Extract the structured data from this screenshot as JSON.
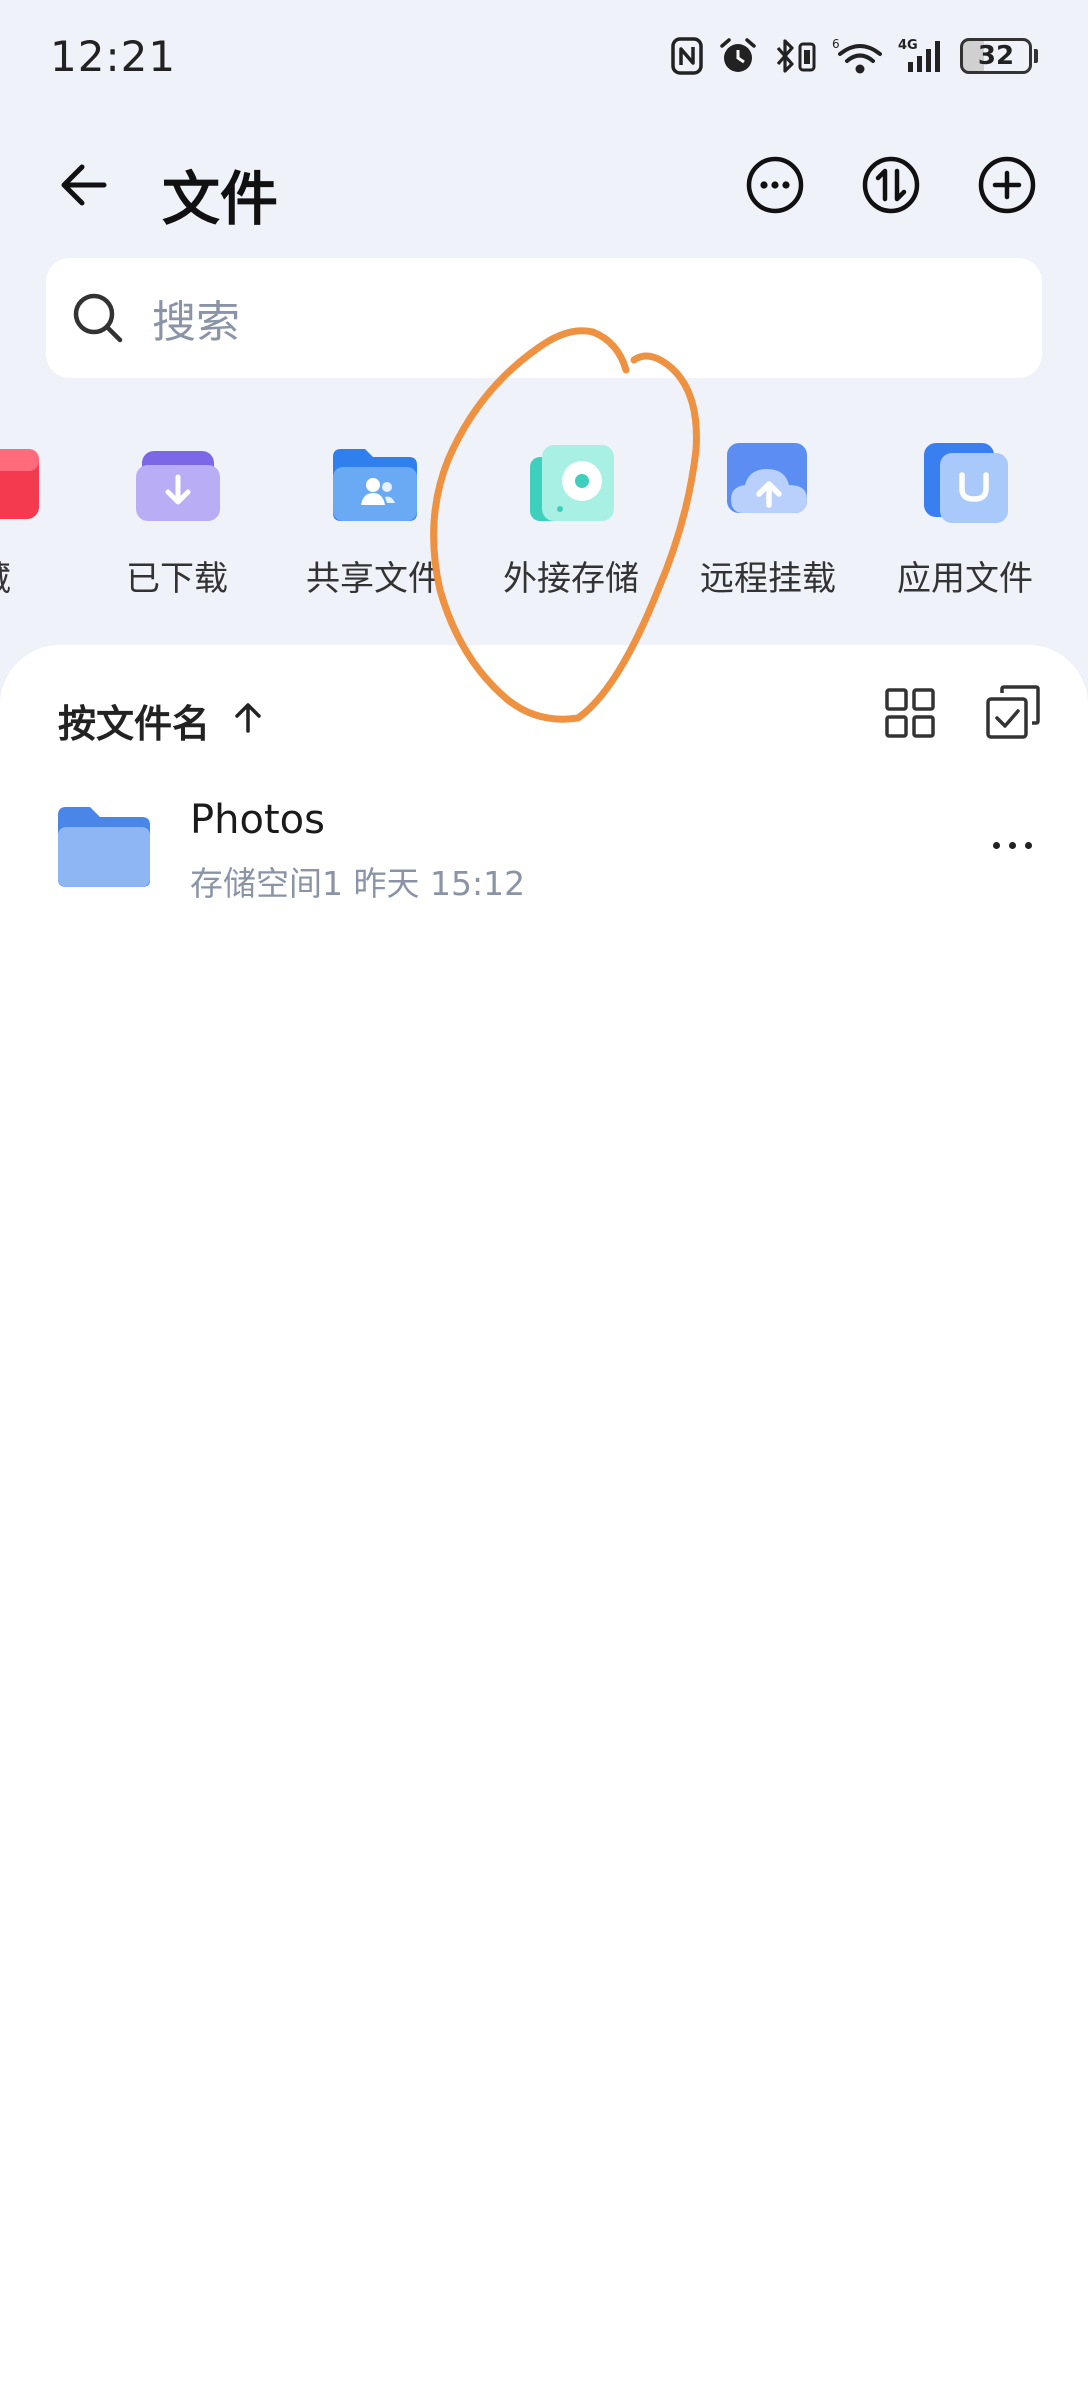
{
  "status_bar": {
    "time": "12:21",
    "network": "4G",
    "battery": "32"
  },
  "header": {
    "title": "文件",
    "back_icon": "arrow-left-icon",
    "actions": [
      "more-circle-icon",
      "transfer-icon",
      "add-circle-icon"
    ]
  },
  "search": {
    "placeholder": "搜索"
  },
  "categories": [
    {
      "label": "藏",
      "icon": "favorites-icon",
      "color": "#f43a4f"
    },
    {
      "label": "已下载",
      "icon": "downloaded-icon",
      "color": "#8f7ef0"
    },
    {
      "label": "共享文件",
      "icon": "shared-folder-icon",
      "color": "#4a90f0"
    },
    {
      "label": "外接存储",
      "icon": "external-storage-icon",
      "color": "#4dd8c8"
    },
    {
      "label": "远程挂载",
      "icon": "remote-mount-icon",
      "color": "#5b8ef0"
    },
    {
      "label": "应用文件",
      "icon": "app-files-icon",
      "color": "#4a8df5"
    }
  ],
  "list": {
    "sort_label": "按文件名",
    "files": [
      {
        "name": "Photos",
        "meta": "存储空间1  昨天 15:12",
        "icon": "folder-icon"
      }
    ]
  },
  "colors": {
    "background": "#eff2f8",
    "annotation": "#ee9242"
  }
}
